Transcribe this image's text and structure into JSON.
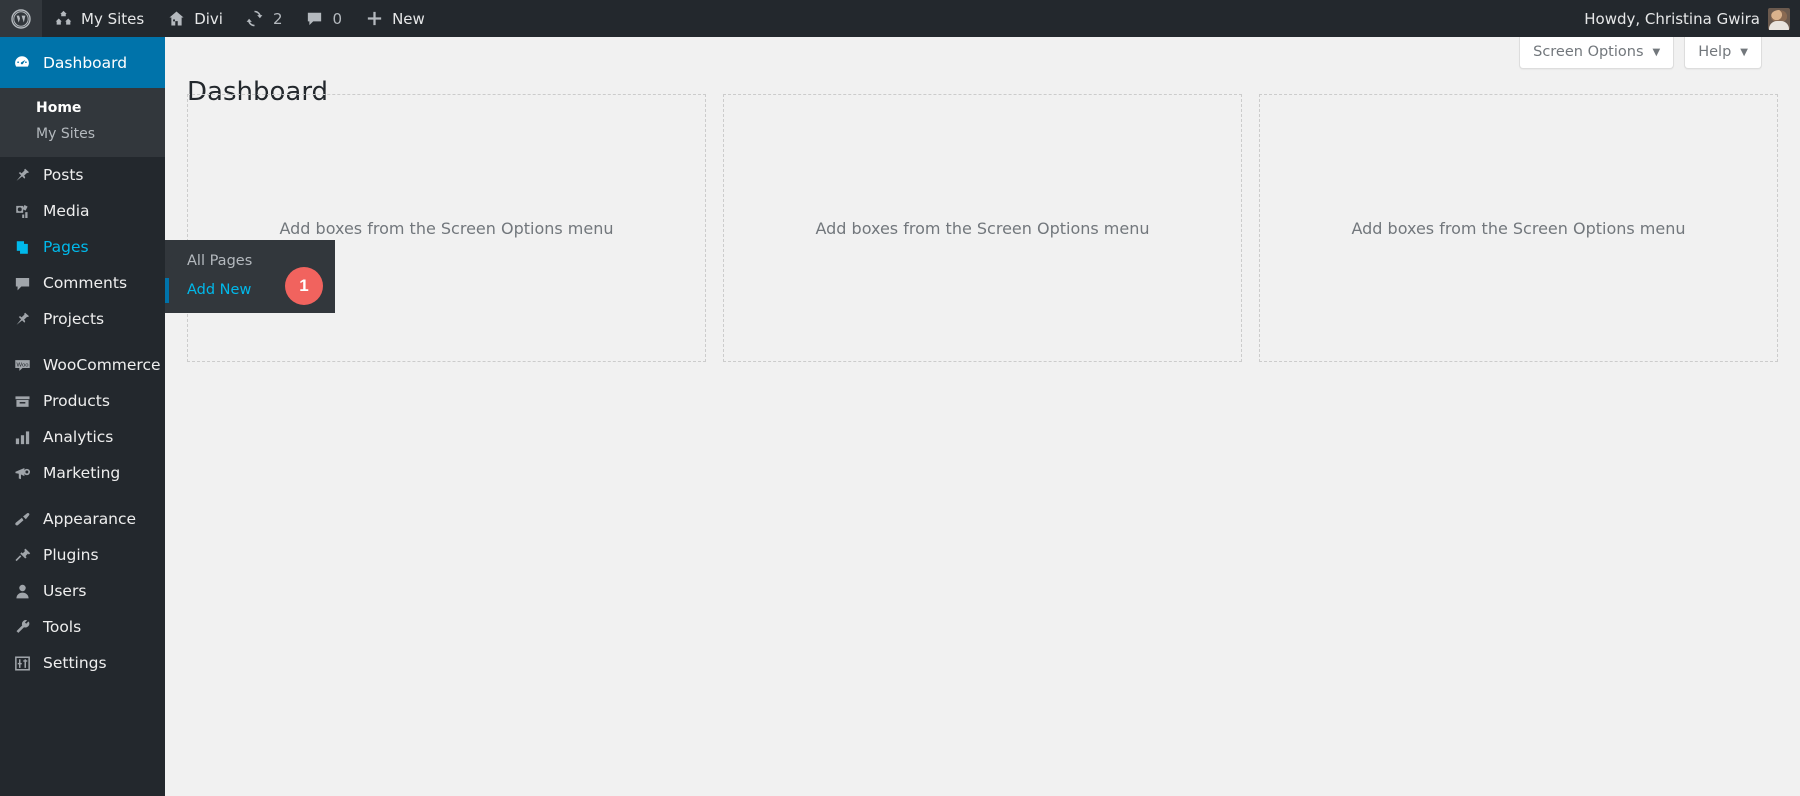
{
  "colors": {
    "adminbar_bg": "#23282d",
    "sidebar_bg": "#23282d",
    "submenu_bg": "#32373c",
    "accent_blue": "#0073aa",
    "hover_blue": "#00b9eb",
    "badge_red": "#f1635e",
    "content_bg": "#f1f1f1"
  },
  "adminbar": {
    "wp_logo_icon": "wordpress-logo-icon",
    "items": [
      {
        "label": "My Sites",
        "icon": "network-sites-icon"
      },
      {
        "label": "Divi",
        "icon": "home-icon"
      },
      {
        "label": "",
        "icon": "updates-refresh-icon",
        "count": "2"
      },
      {
        "label": "",
        "icon": "comment-bubble-icon",
        "count": "0"
      },
      {
        "label": "New",
        "icon": "plus-icon"
      }
    ],
    "howdy": "Howdy, Christina Gwira",
    "avatar_icon": "user-avatar"
  },
  "sidebar": {
    "active": {
      "label": "Dashboard",
      "icon": "dashboard-gauge-icon",
      "submenu": [
        {
          "label": "Home",
          "current": true
        },
        {
          "label": "My Sites",
          "current": false
        }
      ]
    },
    "items": [
      {
        "label": "Posts",
        "icon": "pushpin-icon",
        "hover": false
      },
      {
        "label": "Media",
        "icon": "media-photos-icon",
        "hover": false
      },
      {
        "label": "Pages",
        "icon": "pages-stack-icon",
        "hover": true
      },
      {
        "label": "Comments",
        "icon": "comment-bubble-icon",
        "hover": false
      },
      {
        "label": "Projects",
        "icon": "pushpin-icon",
        "hover": false
      },
      {
        "separator": true
      },
      {
        "label": "WooCommerce",
        "icon": "woocommerce-icon",
        "hover": false
      },
      {
        "label": "Products",
        "icon": "products-box-icon",
        "hover": false
      },
      {
        "label": "Analytics",
        "icon": "bar-chart-icon",
        "hover": false
      },
      {
        "label": "Marketing",
        "icon": "megaphone-icon",
        "hover": false
      },
      {
        "separator": true
      },
      {
        "label": "Appearance",
        "icon": "paintbrush-icon",
        "hover": false
      },
      {
        "label": "Plugins",
        "icon": "plug-icon",
        "hover": false
      },
      {
        "label": "Users",
        "icon": "user-icon",
        "hover": false
      },
      {
        "label": "Tools",
        "icon": "wrench-icon",
        "hover": false
      },
      {
        "label": "Settings",
        "icon": "settings-sliders-icon",
        "hover": false
      }
    ]
  },
  "flyout": {
    "parent": "Pages",
    "items": [
      {
        "label": "All Pages",
        "current": false
      },
      {
        "label": "Add New",
        "current": true
      }
    ],
    "badge": "1"
  },
  "screen_meta": {
    "screen_options_label": "Screen Options",
    "help_label": "Help",
    "caret": "▼"
  },
  "main": {
    "title": "Dashboard",
    "empty_box_text": "Add boxes from the Screen Options menu",
    "boxes": [
      "Add boxes from the Screen Options menu",
      "Add boxes from the Screen Options menu",
      "Add boxes from the Screen Options menu"
    ]
  }
}
